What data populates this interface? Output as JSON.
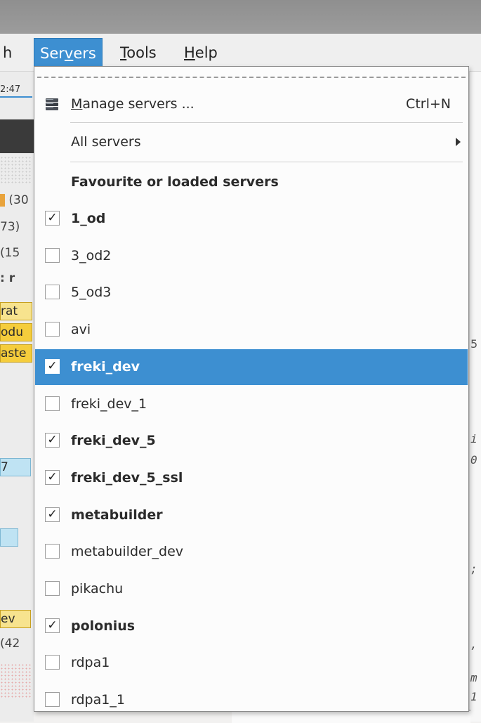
{
  "menubar": {
    "items": [
      {
        "id": "search",
        "label": "h"
      },
      {
        "id": "servers",
        "label_pre": "Ser",
        "label_u": "v",
        "label_post": "ers"
      },
      {
        "id": "tools",
        "label_u": "T",
        "label_post": "ools"
      },
      {
        "id": "help",
        "label_u": "H",
        "label_post": "elp"
      }
    ]
  },
  "background": {
    "time_fragment": "2:47",
    "left_fragments": [
      "(30",
      "73)",
      "(15",
      ": r",
      "rat",
      "odu",
      "aste",
      "7",
      "ev",
      "(42"
    ],
    "right_fragments": [
      "5",
      "i",
      "0",
      ";",
      ",",
      "m",
      "1"
    ]
  },
  "servers_menu": {
    "manage": {
      "label_u": "M",
      "label_post": "anage servers ...",
      "shortcut": "Ctrl+N"
    },
    "all_servers": "All servers",
    "section_title": "Favourite or loaded servers",
    "servers": [
      {
        "name": "1_od",
        "checked": true
      },
      {
        "name": "3_od2",
        "checked": false
      },
      {
        "name": "5_od3",
        "checked": false
      },
      {
        "name": "avi",
        "checked": false
      },
      {
        "name": "freki_dev",
        "checked": true
      },
      {
        "name": "freki_dev_1",
        "checked": false
      },
      {
        "name": "freki_dev_5",
        "checked": true
      },
      {
        "name": "freki_dev_5_ssl",
        "checked": true
      },
      {
        "name": "metabuilder",
        "checked": true
      },
      {
        "name": "metabuilder_dev",
        "checked": false
      },
      {
        "name": "pikachu",
        "checked": false
      },
      {
        "name": "polonius",
        "checked": true
      },
      {
        "name": "rdpa1",
        "checked": false
      },
      {
        "name": "rdpa1_1",
        "checked": false
      }
    ],
    "checkmark": "✓",
    "highlight_color": "#3d8fd1"
  }
}
